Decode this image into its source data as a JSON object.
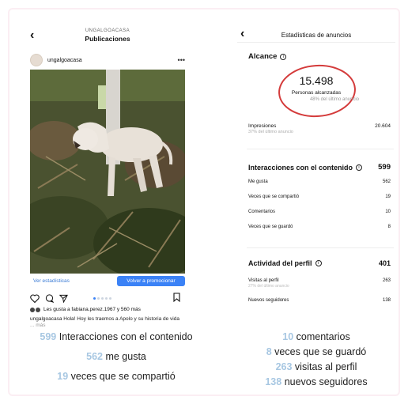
{
  "left_phone": {
    "header_sub": "UNGALGOACASA",
    "header_title": "Publicaciones",
    "username": "ungalgoacasa",
    "stats_link": "Ver estadísticas",
    "promote_button": "Volver a promocionar",
    "likes_text": "Les gusta a fabiana.perez.1967 y 560 más",
    "caption": "ungalgoacasa Hola! Hoy les traemos a Apolo y su historia de vida",
    "caption_more": "... más"
  },
  "right_phone": {
    "header_title": "Estadísticas de anuncios",
    "reach": {
      "title": "Alcance",
      "value": "15.498",
      "label": "Personas alcanzadas",
      "compare": "48% del último anuncio"
    },
    "impressions": {
      "label": "Impresiones",
      "value": "20.604",
      "compare": "37% del último anuncio"
    },
    "interactions": {
      "title": "Interacciones con el contenido",
      "total": "599",
      "rows": [
        {
          "label": "Me gusta",
          "value": "562"
        },
        {
          "label": "Veces que se compartió",
          "value": "19"
        },
        {
          "label": "Comentarios",
          "value": "10"
        },
        {
          "label": "Veces que se guardó",
          "value": "8"
        }
      ]
    },
    "profile_activity": {
      "title": "Actividad del perfil",
      "total": "401",
      "visits_label": "Visitas al perfil",
      "visits_value": "263",
      "visits_compare": "27% del último anuncio",
      "followers_label": "Nuevos seguidores",
      "followers_value": "138"
    }
  },
  "summary_left": [
    {
      "num": "599",
      "text": " Interacciones con el contenido"
    },
    {
      "num": "562",
      "text": " me gusta"
    },
    {
      "num": "19",
      "text": " veces que se compartió"
    }
  ],
  "summary_right": [
    {
      "num": "10",
      "text": " comentarios"
    },
    {
      "num": "8",
      "text": " veces que se guardó"
    },
    {
      "num": "263",
      "text": " visitas al perfil"
    },
    {
      "num": "138",
      "text": " nuevos seguidores"
    }
  ],
  "colors": {
    "accent_blue": "#3b82f6",
    "circle_red": "#d43b3b",
    "summary_number": "#a7c7e2"
  }
}
